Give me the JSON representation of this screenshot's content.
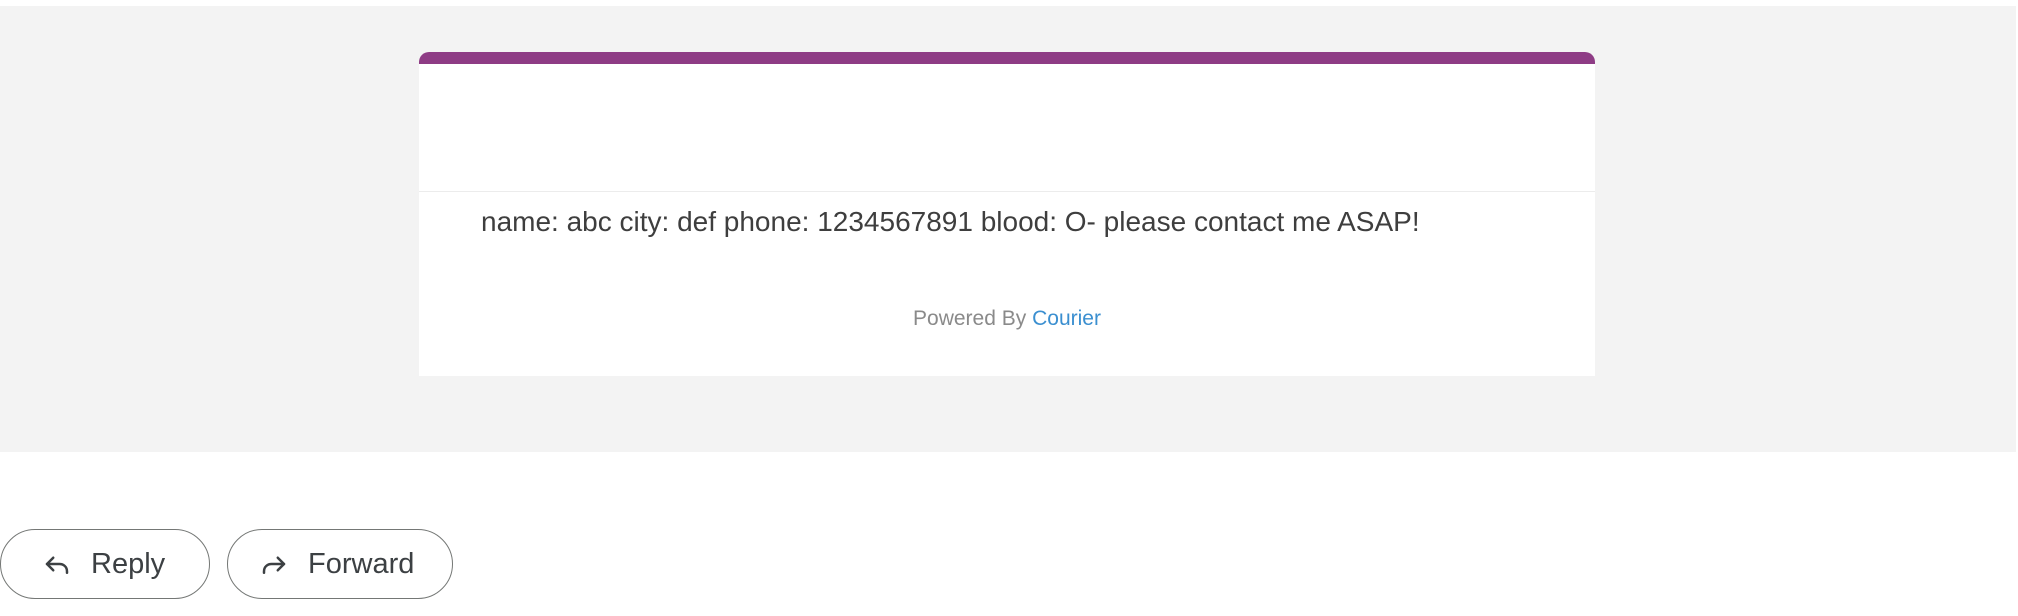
{
  "email": {
    "message": "name: abc city: def phone: 1234567891 blood: O- please contact me ASAP!",
    "footer_prefix": "Powered By",
    "footer_link": "Courier",
    "accent_color": "#8e3c85",
    "link_color": "#3b8fd0"
  },
  "actions": {
    "reply_label": "Reply",
    "reply_icon": "reply-icon",
    "forward_label": "Forward",
    "forward_icon": "forward-icon"
  }
}
